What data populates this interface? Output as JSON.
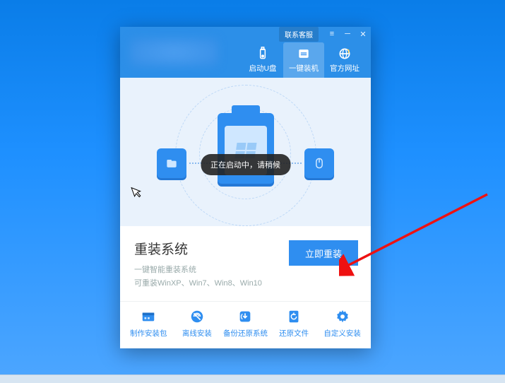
{
  "window": {
    "contact_label": "联系客服",
    "header_tabs": [
      {
        "label": "启动U盘"
      },
      {
        "label": "一键装机"
      },
      {
        "label": "官方网址"
      }
    ]
  },
  "toast": {
    "message": "正在启动中，请稍候"
  },
  "reinstall": {
    "title": "重装系统",
    "subtitle1": "一键智能重装系统",
    "subtitle2": "可重装WinXP、Win7、Win8、Win10",
    "button_label": "立即重装"
  },
  "bottom_actions": [
    {
      "label": "制作安装包"
    },
    {
      "label": "离线安装"
    },
    {
      "label": "备份还原系统"
    },
    {
      "label": "还原文件"
    },
    {
      "label": "自定义安装"
    }
  ],
  "colors": {
    "accent": "#2f8ef0"
  }
}
